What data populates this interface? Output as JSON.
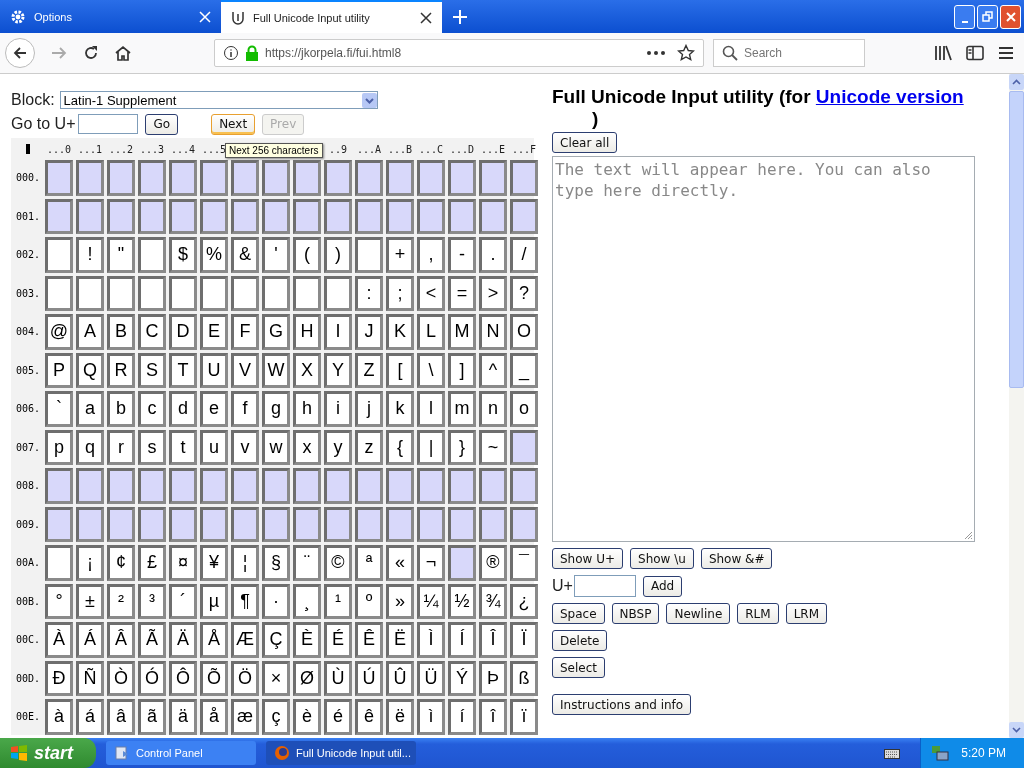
{
  "tabs": [
    {
      "label": "Options",
      "selected": false
    },
    {
      "label": "Full Unicode Input utility",
      "selected": true
    }
  ],
  "address_bar": {
    "url": "https://jkorpela.fi/fui.html8"
  },
  "search": {
    "placeholder": "Search"
  },
  "block": {
    "label": "Block:",
    "value": "Latin-1 Supplement"
  },
  "goto": {
    "label": "Go to U+",
    "buttons": [
      {
        "label": "Go",
        "disabled": false,
        "hovered": false
      },
      {
        "label": "Next",
        "disabled": false,
        "hovered": true
      },
      {
        "label": "Prev",
        "disabled": true,
        "hovered": false
      }
    ]
  },
  "tooltip": "Next 256 characters",
  "column_headers_before_tooltip": [
    "...0",
    "...1",
    "...2",
    "...3",
    "...4",
    "...5"
  ],
  "column_headers_after_tooltip": [
    "..9",
    "...A",
    "...B",
    "...C",
    "...D",
    "...E",
    "...F"
  ],
  "rows": [
    {
      "label": "000.",
      "cells": [
        {
          "kind": "unassigned"
        },
        {
          "kind": "unassigned"
        },
        {
          "kind": "unassigned"
        },
        {
          "kind": "unassigned"
        },
        {
          "kind": "unassigned"
        },
        {
          "kind": "unassigned"
        },
        {
          "kind": "unassigned"
        },
        {
          "kind": "unassigned"
        },
        {
          "kind": "unassigned"
        },
        {
          "kind": "unassigned"
        },
        {
          "kind": "unassigned"
        },
        {
          "kind": "unassigned"
        },
        {
          "kind": "unassigned"
        },
        {
          "kind": "unassigned"
        },
        {
          "kind": "unassigned"
        },
        {
          "kind": "unassigned"
        }
      ]
    },
    {
      "label": "001.",
      "cells": [
        {
          "kind": "unassigned"
        },
        {
          "kind": "unassigned"
        },
        {
          "kind": "unassigned"
        },
        {
          "kind": "unassigned"
        },
        {
          "kind": "unassigned"
        },
        {
          "kind": "unassigned"
        },
        {
          "kind": "unassigned"
        },
        {
          "kind": "unassigned"
        },
        {
          "kind": "unassigned"
        },
        {
          "kind": "unassigned"
        },
        {
          "kind": "unassigned"
        },
        {
          "kind": "unassigned"
        },
        {
          "kind": "unassigned"
        },
        {
          "kind": "unassigned"
        },
        {
          "kind": "unassigned"
        },
        {
          "kind": "unassigned"
        }
      ]
    },
    {
      "label": "002.",
      "cells": [
        {
          "kind": "blank"
        },
        "!",
        "\"",
        {
          "kind": "blank"
        },
        "$",
        "%",
        "&",
        "'",
        "(",
        ")",
        {
          "kind": "blank"
        },
        "+",
        ",",
        "-",
        ".",
        "/"
      ]
    },
    {
      "label": "003.",
      "cells": [
        {
          "kind": "blank"
        },
        {
          "kind": "blank"
        },
        {
          "kind": "blank"
        },
        {
          "kind": "blank"
        },
        {
          "kind": "blank"
        },
        {
          "kind": "blank"
        },
        {
          "kind": "blank"
        },
        {
          "kind": "blank"
        },
        {
          "kind": "blank"
        },
        {
          "kind": "blank"
        },
        ":",
        ";",
        "<",
        "=",
        ">",
        "?"
      ]
    },
    {
      "label": "004.",
      "cells": [
        "@",
        "A",
        "B",
        "C",
        "D",
        "E",
        "F",
        "G",
        "H",
        "I",
        "J",
        "K",
        "L",
        "M",
        "N",
        "O"
      ]
    },
    {
      "label": "005.",
      "cells": [
        "P",
        "Q",
        "R",
        "S",
        "T",
        "U",
        "V",
        "W",
        "X",
        "Y",
        "Z",
        "[",
        "\\",
        "]",
        "^",
        "_"
      ]
    },
    {
      "label": "006.",
      "cells": [
        "`",
        "a",
        "b",
        "c",
        "d",
        "e",
        "f",
        "g",
        "h",
        "i",
        "j",
        "k",
        "l",
        "m",
        "n",
        "o"
      ]
    },
    {
      "label": "007.",
      "cells": [
        "p",
        "q",
        "r",
        "s",
        "t",
        "u",
        "v",
        "w",
        "x",
        "y",
        "z",
        "{",
        "|",
        "}",
        "~",
        {
          "kind": "unassigned"
        }
      ]
    },
    {
      "label": "008.",
      "cells": [
        {
          "kind": "unassigned"
        },
        {
          "kind": "unassigned"
        },
        {
          "kind": "unassigned"
        },
        {
          "kind": "unassigned"
        },
        {
          "kind": "unassigned"
        },
        {
          "kind": "unassigned"
        },
        {
          "kind": "unassigned"
        },
        {
          "kind": "unassigned"
        },
        {
          "kind": "unassigned"
        },
        {
          "kind": "unassigned"
        },
        {
          "kind": "unassigned"
        },
        {
          "kind": "unassigned"
        },
        {
          "kind": "unassigned"
        },
        {
          "kind": "unassigned"
        },
        {
          "kind": "unassigned"
        },
        {
          "kind": "unassigned"
        }
      ]
    },
    {
      "label": "009.",
      "cells": [
        {
          "kind": "unassigned"
        },
        {
          "kind": "unassigned"
        },
        {
          "kind": "unassigned"
        },
        {
          "kind": "unassigned"
        },
        {
          "kind": "unassigned"
        },
        {
          "kind": "unassigned"
        },
        {
          "kind": "unassigned"
        },
        {
          "kind": "unassigned"
        },
        {
          "kind": "unassigned"
        },
        {
          "kind": "unassigned"
        },
        {
          "kind": "unassigned"
        },
        {
          "kind": "unassigned"
        },
        {
          "kind": "unassigned"
        },
        {
          "kind": "unassigned"
        },
        {
          "kind": "unassigned"
        },
        {
          "kind": "unassigned"
        }
      ]
    },
    {
      "label": "00A.",
      "cells": [
        {
          "kind": "blank"
        },
        "¡",
        "¢",
        "£",
        "¤",
        "¥",
        "¦",
        "§",
        "¨",
        "©",
        "ª",
        "«",
        "¬",
        {
          "kind": "unassigned"
        },
        "®",
        "¯"
      ]
    },
    {
      "label": "00B.",
      "cells": [
        "°",
        "±",
        "²",
        "³",
        "´",
        "µ",
        "¶",
        "·",
        "¸",
        "¹",
        "º",
        "»",
        "¼",
        "½",
        "¾",
        "¿"
      ]
    },
    {
      "label": "00C.",
      "cells": [
        "À",
        "Á",
        "Â",
        "Ã",
        "Ä",
        "Å",
        "Æ",
        "Ç",
        "È",
        "É",
        "Ê",
        "Ë",
        "Ì",
        "Í",
        "Î",
        "Ï"
      ]
    },
    {
      "label": "00D.",
      "cells": [
        "Ð",
        "Ñ",
        "Ò",
        "Ó",
        "Ô",
        "Õ",
        "Ö",
        "×",
        "Ø",
        "Ù",
        "Ú",
        "Û",
        "Ü",
        "Ý",
        "Þ",
        "ß"
      ]
    },
    {
      "label": "00E.",
      "cells": [
        "à",
        "á",
        "â",
        "ã",
        "ä",
        "å",
        "æ",
        "ç",
        "è",
        "é",
        "ê",
        "ë",
        "ì",
        "í",
        "î",
        "ï"
      ]
    }
  ],
  "heading": {
    "text": "Full Unicode Input utility (for",
    "link": "Unicode version",
    "closing": ")"
  },
  "clear_button": "Clear all",
  "output": {
    "placeholder": "The text will appear here. You can also type here directly."
  },
  "show_buttons": [
    "Show U+",
    "Show \\u",
    "Show &#"
  ],
  "code_input": {
    "label": "U+",
    "button": "Add"
  },
  "insert_buttons": [
    "Space",
    "NBSP",
    "Newline",
    "RLM",
    "LRM"
  ],
  "edit_buttons": [
    "Delete",
    "Select"
  ],
  "info_button": "Instructions and info",
  "taskbar": {
    "start": "start",
    "items": [
      {
        "label": "Control Panel",
        "active": false
      },
      {
        "label": "Full Unicode Input util...",
        "active": true
      }
    ],
    "clock": "5:20 PM"
  }
}
